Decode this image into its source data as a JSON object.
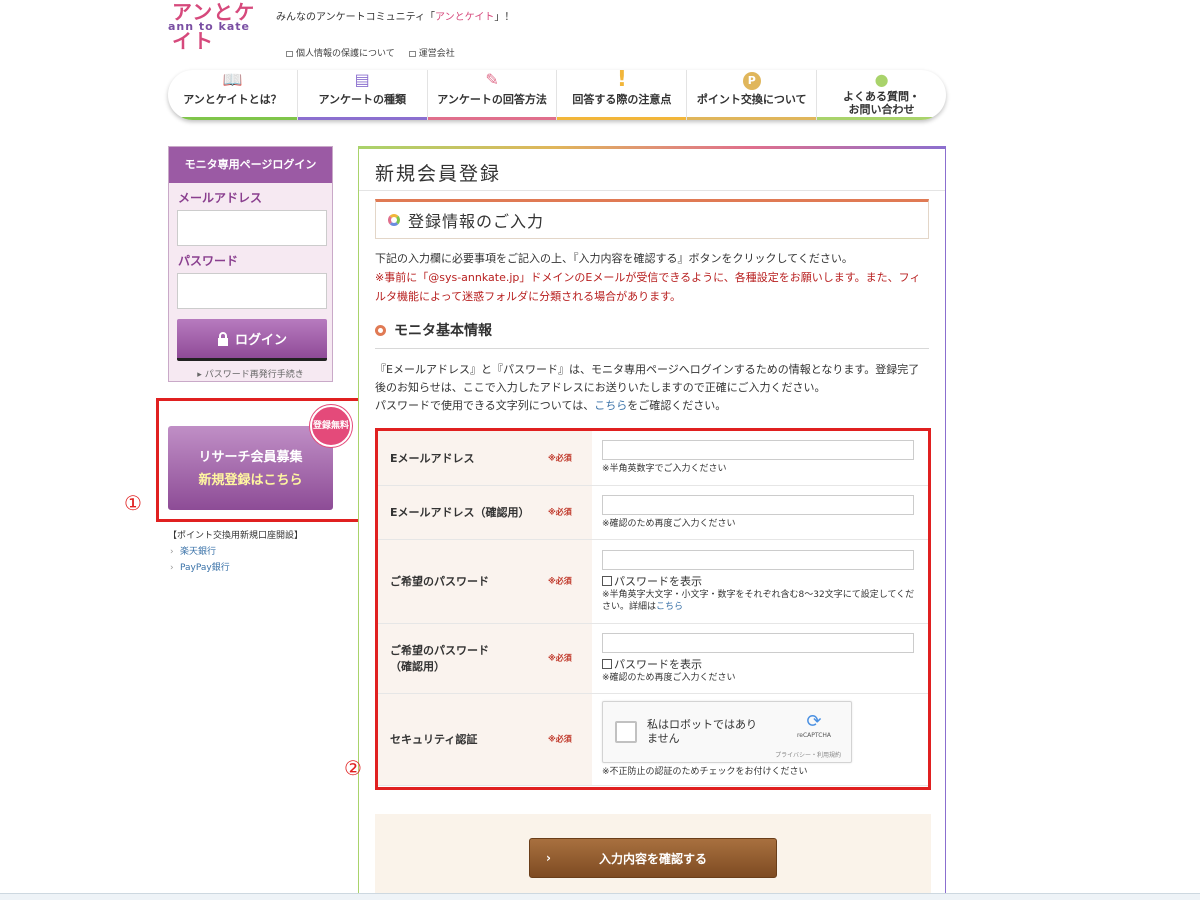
{
  "header": {
    "logo_top": "アンとケイト",
    "logo_bottom": "ann to kate",
    "tagline_pre": "みんなのアンケートコミュニティ「",
    "tagline_hl": "アンとケイト",
    "tagline_post": "」！",
    "links": [
      "個人情報の保護について",
      "運営会社"
    ]
  },
  "nav": {
    "items": [
      {
        "label": "アンとケイトとは？",
        "icon": "book-icon",
        "glyph": "📖",
        "color": "#7fc54a"
      },
      {
        "label": "アンケートの種類",
        "icon": "document-icon",
        "glyph": "▤",
        "color": "#8b6fcf"
      },
      {
        "label": "アンケートの回答方法",
        "icon": "pencil-icon",
        "glyph": "✎",
        "color": "#e06f8c"
      },
      {
        "label": "回答する際の注意点",
        "icon": "exclamation-icon",
        "glyph": "!",
        "color": "#f2b63a"
      },
      {
        "label": "ポイント交換について",
        "icon": "points-bag-icon",
        "glyph": "P",
        "color": "#e0b65b"
      },
      {
        "label": "よくある質問・お問い合わせ",
        "icon": "person-icon",
        "glyph": "●",
        "color": "#a9d36b"
      }
    ]
  },
  "sidebar": {
    "login_title": "モニタ専用ページログイン",
    "email_label": "メールアドレス",
    "password_label": "パスワード",
    "login_button": "ログイン",
    "pw_reset": "パスワード再発行手続き",
    "banner_line1": "リサーチ会員募集",
    "banner_line2": "新規登録はこちら",
    "badge": "登録無料",
    "marker1": "①",
    "bank_heading": "【ポイント交換用新規口座開設】",
    "bank_links": [
      "楽天銀行",
      "PayPay銀行"
    ]
  },
  "main": {
    "title": "新規会員登録",
    "section_title": "登録情報のご入力",
    "intro": "下記の入力欄に必要事項をご記入の上、『入力内容を確認する』ボタンをクリックしてください。",
    "warning": "※事前に「@sys-annkate.jp」ドメインのEメールが受信できるように、各種設定をお願いします。また、フィルタ機能によって迷惑フォルダに分類される場合があります。",
    "subsection_title": "モニタ基本情報",
    "desc_line1": "『Eメールアドレス』と『パスワード』は、モニタ専用ページへログインするための情報となります。登録完了後のお知らせは、ここで入力したアドレスにお送りいたしますので正確にご入力ください。",
    "desc_line2_pre": "パスワードで使用できる文字列については、",
    "desc_line2_link": "こちら",
    "desc_line2_post": "をご確認ください。",
    "marker2": "②",
    "required": "※必須",
    "fields": [
      {
        "label": "Eメールアドレス",
        "note": "※半角英数字でご入力ください"
      },
      {
        "label": "Eメールアドレス（確認用）",
        "note": "※確認のため再度ご入力ください"
      },
      {
        "label": "ご希望のパスワード",
        "show_pw": "パスワードを表示",
        "note": "※半角英字大文字・小文字・数字をそれぞれ含む8〜32文字にて設定してください。詳細は",
        "note_link": "こちら"
      },
      {
        "label_line1": "ご希望のパスワード",
        "label_line2": "（確認用）",
        "show_pw": "パスワードを表示",
        "note": "※確認のため再度ご入力ください"
      },
      {
        "label": "セキュリティ認証",
        "note": "※不正防止の認証のためチェックをお付けください"
      }
    ],
    "captcha": {
      "text": "私はロボットではありません",
      "brand": "reCAPTCHA",
      "privacy": "プライバシー・利用規約"
    },
    "submit_label": "入力内容を確認する"
  }
}
